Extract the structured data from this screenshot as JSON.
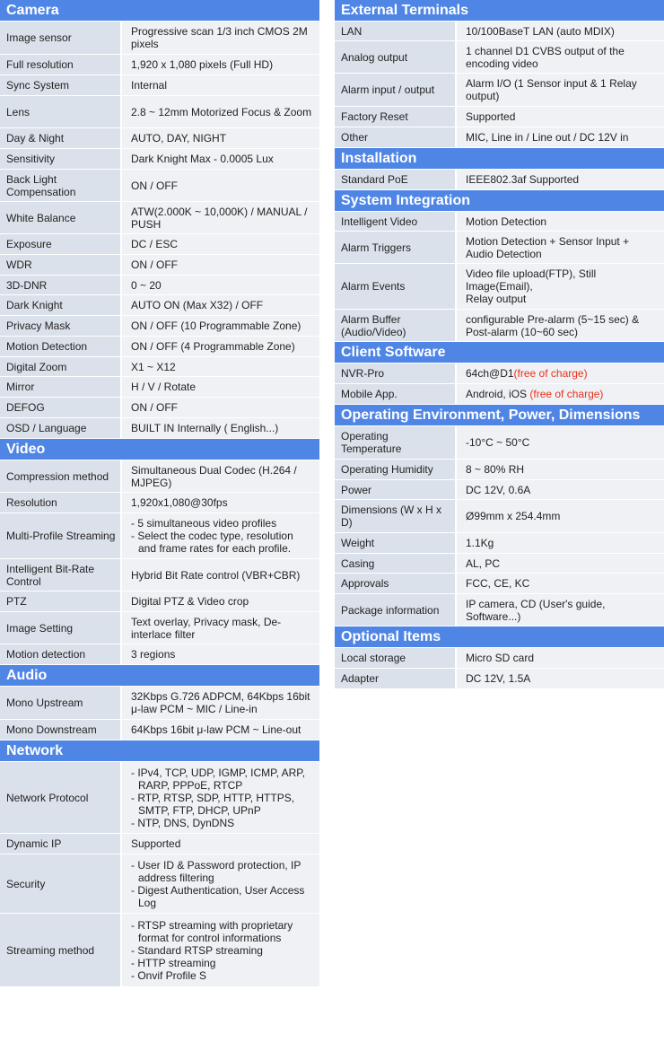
{
  "colors": {
    "header_bg": "#4f86e6",
    "key_bg": "#dbe1ea",
    "value_bg": "#eff1f5",
    "highlight": "#e8321a"
  },
  "left": [
    {
      "title": "Camera",
      "rows": [
        {
          "k": "Image sensor",
          "v": "Progressive scan 1/3 inch CMOS  2M pixels",
          "h": 37
        },
        {
          "k": "Full resolution",
          "v": "1,920 x 1,080 pixels (Full HD)",
          "h": 23
        },
        {
          "k": "Sync System",
          "v": "Internal",
          "h": 23
        },
        {
          "k": "Lens",
          "v": "2.8 ~ 12mm Motorized Focus & Zoom",
          "h": 36
        },
        {
          "k": "Day & Night",
          "v": "AUTO, DAY, NIGHT",
          "h": 23
        },
        {
          "k": "Sensitivity",
          "v": "Dark Knight Max - 0.0005 Lux",
          "h": 23
        },
        {
          "k": "Back Light Compensation",
          "v": "ON / OFF",
          "h": 36
        },
        {
          "k": "White Balance",
          "v": "ATW(2.000K ~ 10,000K) / MANUAL / PUSH",
          "h": 36
        },
        {
          "k": "Exposure",
          "v": "DC / ESC",
          "h": 23
        },
        {
          "k": "WDR",
          "v": "ON / OFF",
          "h": 23
        },
        {
          "k": "3D-DNR",
          "v": "0 ~ 20",
          "h": 22
        },
        {
          "k": "Dark Knight",
          "v": "AUTO ON  (Max X32) / OFF",
          "h": 23
        },
        {
          "k": "Privacy Mask",
          "v": "ON / OFF (10 Programmable  Zone)",
          "h": 23
        },
        {
          "k": "Motion Detection",
          "v": "ON / OFF  (4 Programmable  Zone)",
          "h": 23
        },
        {
          "k": "Digital Zoom",
          "v": "X1 ~ X12",
          "h": 22
        },
        {
          "k": "Mirror",
          "v": "H / V / Rotate",
          "h": 23
        },
        {
          "k": "DEFOG",
          "v": "ON / OFF",
          "h": 23
        },
        {
          "k": "OSD / Language",
          "v": "BUILT  IN  Internally ( English...)",
          "h": 23
        }
      ]
    },
    {
      "title": "Video",
      "rows": [
        {
          "k": "Compression method",
          "v": "Simultaneous Dual Codec  (H.264 / MJPEG)",
          "h": 36
        },
        {
          "k": "Resolution",
          "v": "1,920x1,080@30fps",
          "h": 23
        },
        {
          "k": "Multi-Profile Streaming",
          "list": [
            "- 5 simultaneous  video profiles",
            "- Select the codec type, resolution and frame rates for each profile."
          ],
          "h": 51
        },
        {
          "k": "Intelligent  Bit-Rate Control",
          "v": "Hybrid Bit Rate  control (VBR+CBR)",
          "h": 36
        },
        {
          "k": "PTZ",
          "v": "Digital  PTZ  &  Video crop",
          "h": 23
        },
        {
          "k": "Image Setting",
          "v": "Text overlay, Privacy mask, De-interlace filter",
          "h": 36
        },
        {
          "k": "Motion detection",
          "v": "3 regions",
          "h": 23
        }
      ]
    },
    {
      "title": "Audio",
      "rows": [
        {
          "k": "Mono  Upstream",
          "v": "32Kbps G.726  ADPCM,  64Kbps 16bit μ-law PCM  ~ MIC  / Line-in",
          "h": 37
        },
        {
          "k": "Mono  Downstream",
          "v": "64Kbps 16bit μ-law PCM ~ Line-out",
          "h": 23
        }
      ]
    },
    {
      "title": "Network",
      "rows": [
        {
          "k": "Network Protocol",
          "list": [
            "- IPv4,  TCP,  UDP,  IGMP,  ICMP, ARP,  RARP,  PPPoE,  RTCP",
            "- RTP,  RTSP,  SDP,  HTTP,  HTTPS, SMTP,  FTP,  DHCP,  UPnP",
            "- NTP,  DNS,  DynDNS"
          ],
          "h": 80
        },
        {
          "k": "Dynamic IP",
          "v": "Supported",
          "h": 23
        },
        {
          "k": "Security",
          "list": [
            "- User ID  & Password protection, IP address filtering",
            "- Digest  Authentication, User Access Log"
          ],
          "h": 66
        },
        {
          "k": "Streaming  method",
          "list": [
            "- RTSP  streaming with proprietary format for control informations",
            "- Standard RTSP  streaming",
            "- HTTP  streaming",
            "- Onvif Profile  S"
          ],
          "h": 82
        }
      ]
    }
  ],
  "right": [
    {
      "title": "External Terminals",
      "rows": [
        {
          "k": "LAN",
          "v": "10/100BaseT LAN (auto MDIX)",
          "h": 22
        },
        {
          "k": "Analog output",
          "v": "1 channel D1 CVBS output of the encoding video",
          "h": 36
        },
        {
          "k": "Alarm input / output",
          "v": "Alarm I/O  (1 Sensor input & 1 Relay output)",
          "h": 37
        },
        {
          "k": "Factory Reset",
          "v": "Supported",
          "h": 23
        },
        {
          "k": "Other",
          "v": "MIC,  Line  in / Line out / DC  12V in",
          "h": 23
        }
      ]
    },
    {
      "title": "Installation",
      "rows": [
        {
          "k": "Standard PoE",
          "v": "IEEE802.3af  Supported",
          "h": 23
        }
      ]
    },
    {
      "title": "System Integration",
      "rows": [
        {
          "k": "Intelligent  Video",
          "v": "Motion  Detection",
          "h": 22
        },
        {
          "k": "Alarm Triggers",
          "v": "Motion Detection + Sensor Input + Audio Detection",
          "h": 36
        },
        {
          "k": "Alarm Events",
          "lines": [
            "Video file upload(FTP),  Still",
            "Image(Email),",
            "Relay output"
          ],
          "h": 51
        },
        {
          "k": "Alarm Buffer (Audio/Video)",
          "v": "configurable Pre-alarm (5~15 sec) & Post-alarm  (10~60 sec)",
          "h": 36
        }
      ]
    },
    {
      "title": "Client Software",
      "rows": [
        {
          "k": "NVR-Pro",
          "v": "64ch@D1",
          "note": "(free of charge)",
          "h": 23
        },
        {
          "k": "Mobile App.",
          "v": "Android, iOS  ",
          "note": "(free of charge)",
          "h": 23
        }
      ]
    },
    {
      "title": "Operating Environment, Power, Dimensions",
      "rows": [
        {
          "k": "Operating Temperature",
          "v": "-10°C ~  50°C",
          "h": 37
        },
        {
          "k": "Operating Humidity",
          "v": "8 ~  80% RH",
          "h": 23
        },
        {
          "k": "Power",
          "v": "DC  12V, 0.6A",
          "h": 22
        },
        {
          "k": "Dimensions  (W x H x D)",
          "v": "Ø99mm  x 254.4mm",
          "h": 37
        },
        {
          "k": "Weight",
          "v": "1.1Kg",
          "h": 23
        },
        {
          "k": "Casing",
          "v": "AL, PC",
          "h": 22
        },
        {
          "k": "Approvals",
          "v": "FCC,  CE,  KC",
          "h": 23
        },
        {
          "k": "Package information",
          "v": "IP camera, CD (User's guide, Software...)",
          "h": 36
        }
      ]
    },
    {
      "title": "Optional Items",
      "rows": [
        {
          "k": "Local storage",
          "v": "Micro SD card",
          "h": 23
        },
        {
          "k": "Adapter",
          "v": "DC  12V, 1.5A",
          "h": 23
        }
      ]
    }
  ]
}
